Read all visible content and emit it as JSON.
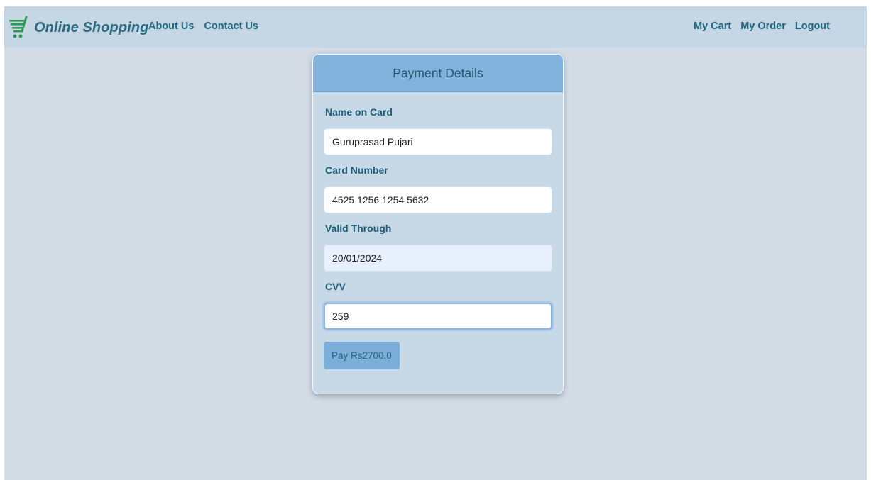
{
  "navbar": {
    "brand": "Online Shopping",
    "brand_icon": "shopping-cart-icon",
    "left_links": [
      "About Us",
      "Contact Us"
    ],
    "right_links": [
      "My Cart",
      "My Order",
      "Logout"
    ],
    "brand_color": "#2a6b80",
    "cart_icon_color": "#2e9a4e"
  },
  "payment": {
    "title": "Payment Details",
    "fields": [
      {
        "label": "Name on Card",
        "value": "Guruprasad Pujari"
      },
      {
        "label": "Card Number",
        "value": "4525 1256 1254 5632"
      },
      {
        "label": "Valid Through",
        "value": "20/01/2024"
      },
      {
        "label": "CVV",
        "value": "259"
      }
    ],
    "pay_button": "Pay Rs2700.0",
    "header_color": "#82b3dc",
    "card_color": "#c7d8e6"
  }
}
